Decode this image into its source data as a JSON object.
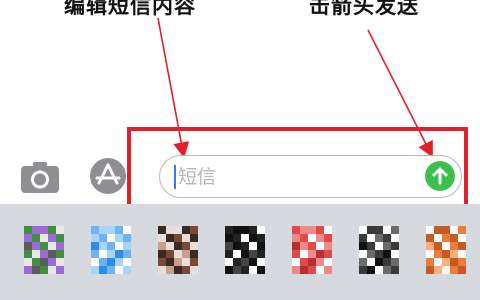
{
  "annotations": {
    "edit_text": "编辑短信内容",
    "send_hint": "击箭头发送"
  },
  "composer": {
    "placeholder": "短信",
    "camera_icon": "camera-icon",
    "appstore_icon": "app-store-icon",
    "send_icon": "arrow-up-icon"
  },
  "app_drawer": {
    "apps": [
      {
        "name": "app-1",
        "colors": [
          "#3f8f3f",
          "#9b6bd8",
          "#e8e8e8",
          "#5b5b5b"
        ]
      },
      {
        "name": "app-2",
        "colors": [
          "#2f8be6",
          "#6fb4f2",
          "#a7d4f7",
          "#ffffff"
        ]
      },
      {
        "name": "app-3",
        "colors": [
          "#7a4a36",
          "#c8a08c",
          "#3a2a24",
          "#e9dfda"
        ]
      },
      {
        "name": "app-4",
        "colors": [
          "#111111",
          "#ffffff",
          "#444444",
          "#222222"
        ]
      },
      {
        "name": "app-5",
        "colors": [
          "#e24a4a",
          "#f08a8a",
          "#ffffff",
          "#b72f2f"
        ]
      },
      {
        "name": "app-6",
        "colors": [
          "#111111",
          "#ffffff",
          "#3a3a3a",
          "#6b6b6b"
        ]
      },
      {
        "name": "app-7",
        "colors": [
          "#f07a3a",
          "#ffb07a",
          "#ffffff",
          "#c55a22"
        ]
      }
    ]
  },
  "colors": {
    "highlight": "#e0202a",
    "send": "#3fbf4f",
    "caret": "#3b79e8",
    "drawer": "#d6d9de"
  }
}
